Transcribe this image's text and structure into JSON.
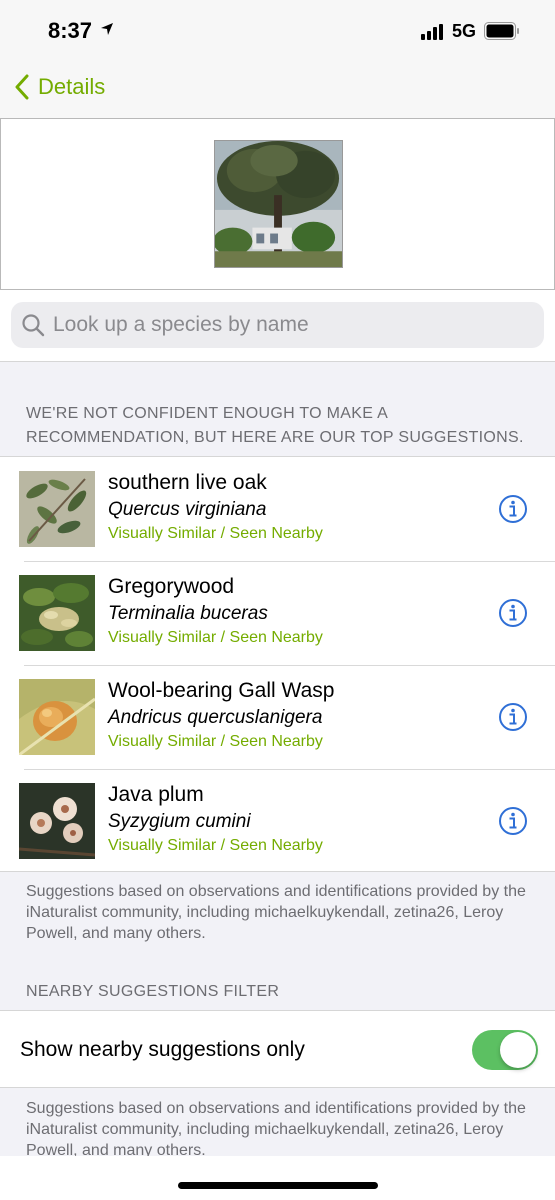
{
  "status_bar": {
    "time": "8:37",
    "network": "5G"
  },
  "nav": {
    "back_label": "Details"
  },
  "search": {
    "placeholder": "Look up a species by name",
    "value": ""
  },
  "suggestions_header": "WE'RE NOT CONFIDENT ENOUGH TO MAKE A RECOMMENDATION, BUT HERE ARE OUR TOP SUGGESTIONS.",
  "suggestions": [
    {
      "common": "southern live oak",
      "scientific": "Quercus virginiana",
      "reason": "Visually Similar / Seen Nearby",
      "thumb": "oak-leaves"
    },
    {
      "common": "Gregorywood",
      "scientific": "Terminalia buceras",
      "reason": "Visually Similar / Seen Nearby",
      "thumb": "gregorywood-foliage"
    },
    {
      "common": "Wool-bearing Gall Wasp",
      "scientific": "Andricus quercuslanigera",
      "reason": "Visually Similar / Seen Nearby",
      "thumb": "wool-gall"
    },
    {
      "common": "Java plum",
      "scientific": "Syzygium cumini",
      "reason": "Visually Similar / Seen Nearby",
      "thumb": "java-plum-flowers"
    }
  ],
  "footnote_1": "Suggestions based on observations and identifications provided by the iNaturalist community, including michaelkuykendall, zetina26, Leroy Powell, and many others.",
  "nearby_header": "NEARBY SUGGESTIONS FILTER",
  "nearby_toggle": {
    "label": "Show nearby suggestions only",
    "on": true
  },
  "footnote_2": "Suggestions based on observations and identifications provided by the iNaturalist community, including michaelkuykendall, zetina26, Leroy Powell, and many others.",
  "colors": {
    "accent": "#74ac00",
    "info_blue": "#2f6fd6",
    "toggle_on": "#5cc062"
  }
}
